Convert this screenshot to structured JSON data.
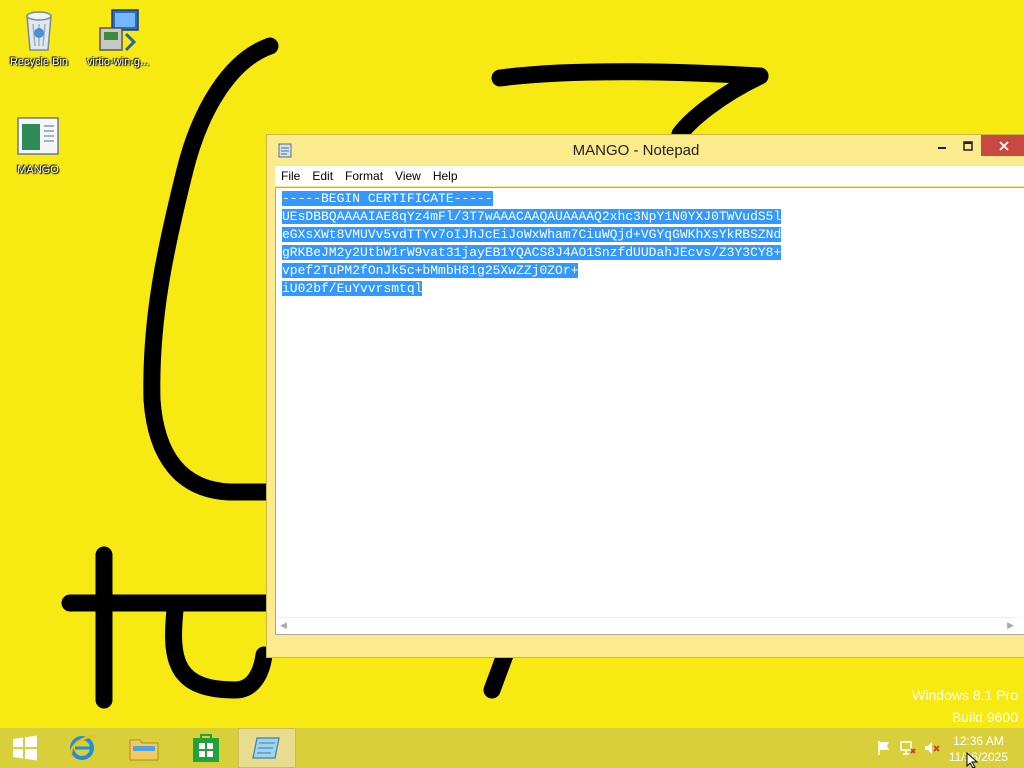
{
  "desktop": {
    "icons": [
      {
        "label": "Recycle Bin",
        "icon": "recycle-bin-icon"
      },
      {
        "label": "virtio-win-g...",
        "icon": "installer-icon"
      },
      {
        "label": "MANGO",
        "icon": "text-file-icon"
      }
    ],
    "wallpaper_color": "#f7ea12"
  },
  "notepad": {
    "title": "MANGO - Notepad",
    "menu": [
      "File",
      "Edit",
      "Format",
      "View",
      "Help"
    ],
    "lines": [
      "-----BEGIN CERTIFICATE-----",
      "UEsDBBQAAAAIAE8qYz4mFl/3T7wAAACAAQAUAAAAQ2xhc3NpY1N0YXJ0TWVudS5l",
      "eGXsXWt8VMUVv5vdTTYv7oIJhJcEiJoWxWham7CiuWQjd+VGYqGWKhXsYkRBSZNd",
      "gRKBeJM2y2UtbW1rW9vat31jayEB1YQACS8J4AO1SnzfdUUDahJEcvs/Z3Y3CY8+",
      "vpef2TuPM2fOnJk5c+bMmbH81g25XwZZj0ZOr+",
      "iU02bf/EuYvvrsmtql"
    ],
    "selection_color": "#3399ff"
  },
  "watermark": {
    "line1": "Windows 8.1 Pro",
    "line2": "Build 9600"
  },
  "taskbar": {
    "buttons": [
      "start-button",
      "internet-explorer",
      "file-explorer",
      "store",
      "notepad"
    ],
    "clock_time": "12:36 AM",
    "clock_date": "11/16/2025"
  }
}
